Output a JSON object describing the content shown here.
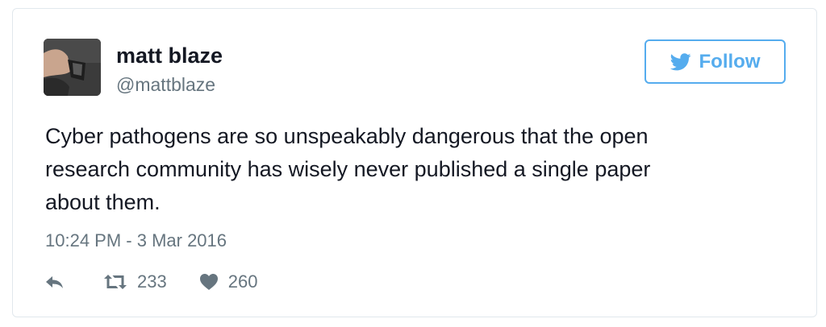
{
  "user": {
    "name": "matt blaze",
    "handle": "@mattblaze"
  },
  "follow_button": {
    "label": "Follow",
    "icon": "twitter-bird-icon"
  },
  "tweet": {
    "text": "Cyber pathogens are so unspeakably dangerous that the open\nresearch community has wisely never published a single paper\nabout them.",
    "timestamp": "10:24 PM - 3 Mar 2016"
  },
  "actions": {
    "reply_icon": "reply-icon",
    "retweet_icon": "retweet-icon",
    "retweet_count": "233",
    "like_icon": "heart-icon",
    "like_count": "260"
  },
  "colors": {
    "accent": "#55acee",
    "text": "#141823",
    "muted": "#66757f",
    "border": "#e1e8ed"
  }
}
